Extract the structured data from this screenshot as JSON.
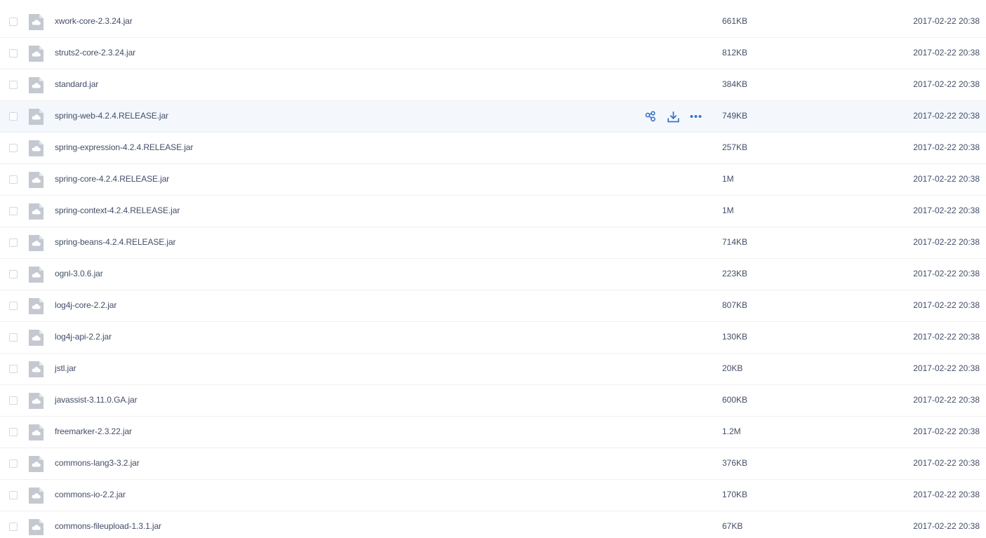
{
  "colors": {
    "text": "#424e67",
    "icon_gray": "#c4c9d1",
    "action_blue": "#3a75c4",
    "row_hover": "#f4f8fd",
    "divider": "#f0f0f0"
  },
  "icons": {
    "file": "cloud-file-icon",
    "share": "share-icon",
    "download": "download-icon",
    "more": "more-icon"
  },
  "files": [
    {
      "name": "xwork-core-2.3.24.jar",
      "size": "661KB",
      "date": "2017-02-22 20:38"
    },
    {
      "name": "struts2-core-2.3.24.jar",
      "size": "812KB",
      "date": "2017-02-22 20:38"
    },
    {
      "name": "standard.jar",
      "size": "384KB",
      "date": "2017-02-22 20:38"
    },
    {
      "name": "spring-web-4.2.4.RELEASE.jar",
      "size": "749KB",
      "date": "2017-02-22 20:38",
      "hovered": true
    },
    {
      "name": "spring-expression-4.2.4.RELEASE.jar",
      "size": "257KB",
      "date": "2017-02-22 20:38"
    },
    {
      "name": "spring-core-4.2.4.RELEASE.jar",
      "size": "1M",
      "date": "2017-02-22 20:38"
    },
    {
      "name": "spring-context-4.2.4.RELEASE.jar",
      "size": "1M",
      "date": "2017-02-22 20:38"
    },
    {
      "name": "spring-beans-4.2.4.RELEASE.jar",
      "size": "714KB",
      "date": "2017-02-22 20:38"
    },
    {
      "name": "ognl-3.0.6.jar",
      "size": "223KB",
      "date": "2017-02-22 20:38"
    },
    {
      "name": "log4j-core-2.2.jar",
      "size": "807KB",
      "date": "2017-02-22 20:38"
    },
    {
      "name": "log4j-api-2.2.jar",
      "size": "130KB",
      "date": "2017-02-22 20:38"
    },
    {
      "name": "jstl.jar",
      "size": "20KB",
      "date": "2017-02-22 20:38"
    },
    {
      "name": "javassist-3.11.0.GA.jar",
      "size": "600KB",
      "date": "2017-02-22 20:38"
    },
    {
      "name": "freemarker-2.3.22.jar",
      "size": "1.2M",
      "date": "2017-02-22 20:38"
    },
    {
      "name": "commons-lang3-3.2.jar",
      "size": "376KB",
      "date": "2017-02-22 20:38"
    },
    {
      "name": "commons-io-2.2.jar",
      "size": "170KB",
      "date": "2017-02-22 20:38"
    },
    {
      "name": "commons-fileupload-1.3.1.jar",
      "size": "67KB",
      "date": "2017-02-22 20:38"
    }
  ]
}
